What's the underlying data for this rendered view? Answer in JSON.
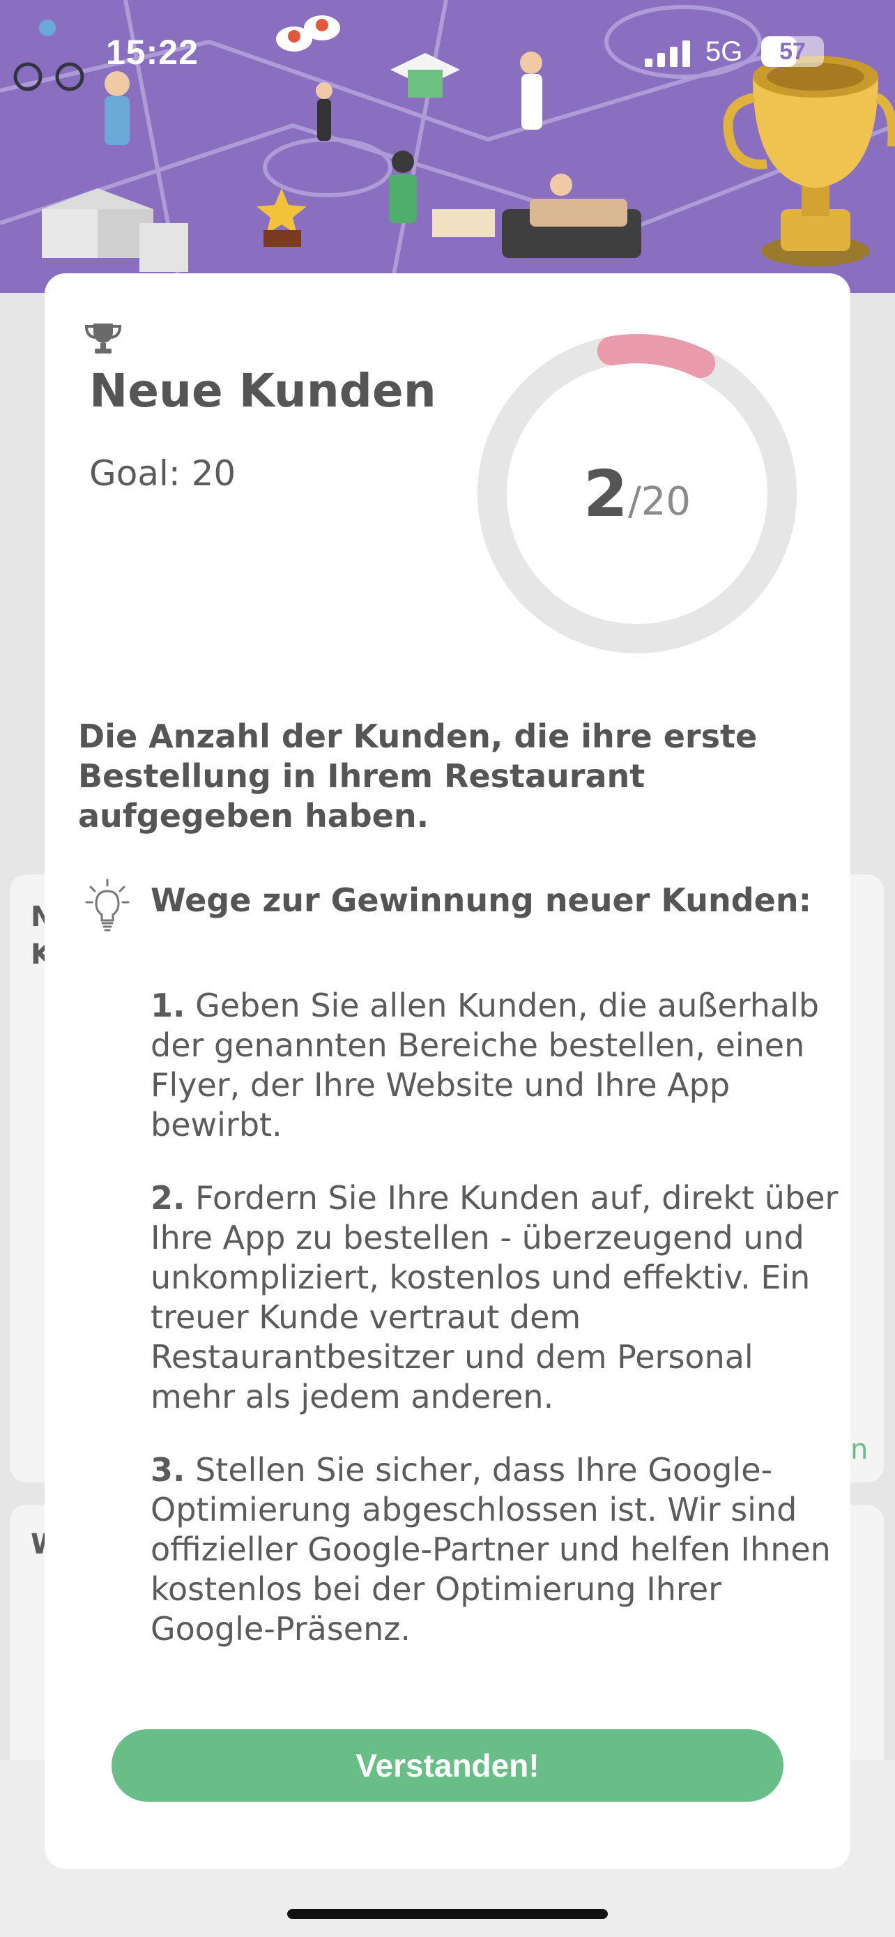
{
  "status_bar": {
    "time": "15:22",
    "network": "5G",
    "battery": "57",
    "battery_level": 0.57
  },
  "modal": {
    "title": "Neue Kunden",
    "goal_label": "Goal: 20",
    "progress": {
      "current": "2",
      "total": "/20",
      "fraction": 0.1
    },
    "description": "Die Anzahl der Kunden, die ihre erste Bestellung in Ihrem Restaurant aufgegeben haben.",
    "tips_heading": "Wege zur Gewinnung neuer Kunden:",
    "tips": [
      {
        "num": "1.",
        "text": " Geben Sie allen Kunden, die außerhalb der genannten Bereiche bestellen, einen Flyer, der Ihre Website und Ihre App bewirbt."
      },
      {
        "num": "2.",
        "text": " Fordern Sie Ihre Kunden auf, direkt über Ihre App zu bestellen - überzeugend und unkompliziert, kostenlos und effektiv. Ein treuer Kunde vertraut dem Restaurantbesitzer und dem Personal mehr als jedem anderen."
      },
      {
        "num": "3.",
        "text": " Stellen Sie sicher, dass Ihre Google-Optimierung abgeschlossen ist. Wir sind offizieller Google-Partner und helfen Ihnen kostenlos bei der Optimierung Ihrer Google-Präsenz."
      }
    ],
    "button_label": "Verstanden!"
  },
  "background": {
    "card1_frag_line1": "N",
    "card1_frag_line2": "K",
    "card2_frag": "W",
    "card1_link_frag": "n"
  },
  "colors": {
    "accent_green": "#69be88",
    "progress_pink": "#e99aab",
    "ring_gray": "#e6e6e6",
    "header_purple": "#8a6fc0"
  }
}
